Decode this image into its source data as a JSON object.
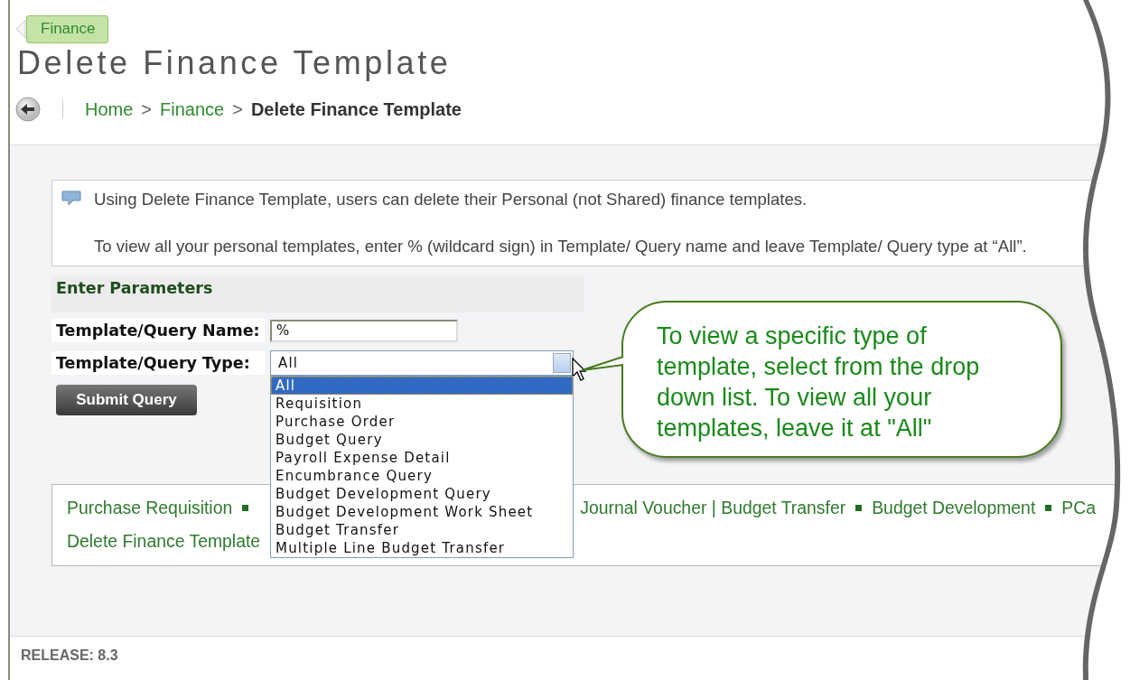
{
  "section_tag": "Finance",
  "title": "Delete Finance Template",
  "breadcrumb": [
    {
      "label": "Home",
      "kind": "link"
    },
    {
      "label": ">",
      "kind": "separator"
    },
    {
      "label": "Finance",
      "kind": "link"
    },
    {
      "label": ">",
      "kind": "separator"
    },
    {
      "label": "Delete Finance Template",
      "kind": "current"
    }
  ],
  "info": [
    "Using Delete Finance Template, users can delete their Personal (not Shared) finance templates.",
    "To view all your personal templates, enter % (wildcard sign) in Template/ Query name and leave Template/ Query type at “All”."
  ],
  "parameters": {
    "header": "Enter Parameters",
    "fields": [
      {
        "label": "Template/Query Name:",
        "kind": "text",
        "value": "%"
      },
      {
        "label": "Template/Query Type:",
        "kind": "select",
        "value": "All",
        "expanded": true,
        "options": [
          {
            "label": "All",
            "selected": true
          },
          {
            "label": "Requisition",
            "selected": false
          },
          {
            "label": "Purchase Order",
            "selected": false
          },
          {
            "label": "Budget Query",
            "selected": false
          },
          {
            "label": "Payroll Expense Detail",
            "selected": false
          },
          {
            "label": "Encumbrance Query",
            "selected": false
          },
          {
            "label": "Budget Development Query",
            "selected": false
          },
          {
            "label": "Budget Development Work Sheet",
            "selected": false
          },
          {
            "label": "Budget Transfer",
            "selected": false
          },
          {
            "label": "Multiple Line Budget Transfer",
            "selected": false
          }
        ]
      }
    ],
    "submit": "Submit Query"
  },
  "links": [
    [
      "Purchase Requisition",
      "Journal Voucher | Budget Transfer",
      "Budget Development",
      "PCa"
    ],
    [
      "Delete Finance Template"
    ]
  ],
  "callout": "To view a specific type of template, select from the drop down list. To view all your templates, leave it at \"All\"",
  "release": "RELEASE: 8.3"
}
